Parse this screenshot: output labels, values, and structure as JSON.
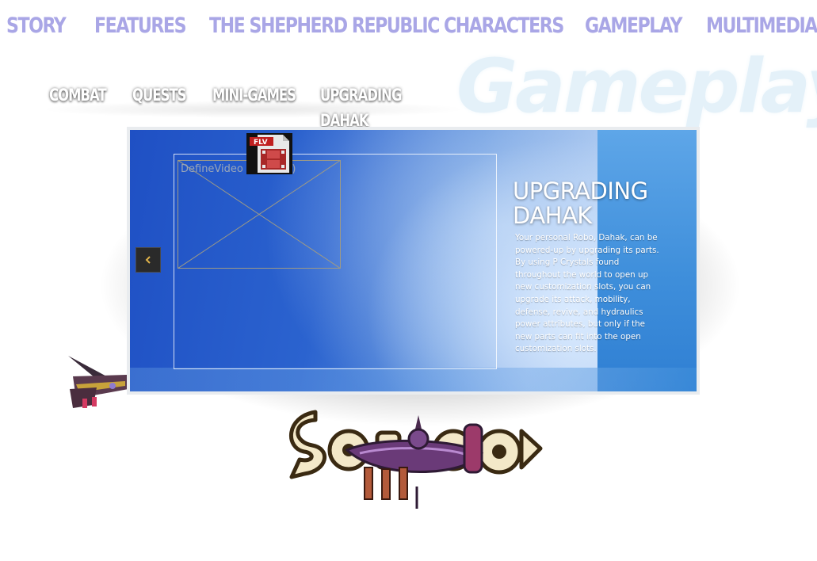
{
  "nav": {
    "items": [
      {
        "label": "Story"
      },
      {
        "label": "Features"
      },
      {
        "label": "The Shepherd Republic"
      },
      {
        "label": "Characters"
      },
      {
        "label": "Gameplay"
      },
      {
        "label": "Multimedia"
      }
    ],
    "color": "#a9a6e6"
  },
  "section": {
    "title": "Gameplay"
  },
  "subnav": {
    "items": [
      {
        "label": "Combat"
      },
      {
        "label": "Quests"
      },
      {
        "label": "Mini-Games"
      },
      {
        "label": "Upgrading Dahak"
      }
    ]
  },
  "video": {
    "placeholder_text": "DefineVideo       (chid: 19)",
    "icon_label": "FLV",
    "icon": "flv-file-icon"
  },
  "slide": {
    "heading_line1": "UPGRADING",
    "heading_line2": "DAHAK",
    "body": "Your personal Robo, Dahak, can be powered-up by upgrading its parts. By using P Crystals found throughout the world to open up new customization slots, you can upgrade its attack, mobility, defense, revive, and hydraulics power attributes, but only if the new parts can fit into the open customization slots.",
    "prev_icon": "chevron-left-icon"
  },
  "colors": {
    "card_blue": "#2b63cf",
    "card_light": "#c9dcf6",
    "accent_gold": "#e0b34a"
  }
}
